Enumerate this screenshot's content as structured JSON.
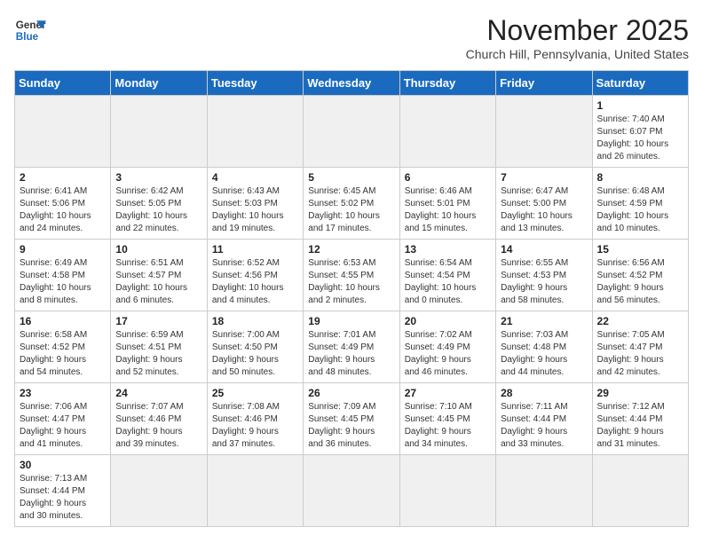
{
  "header": {
    "logo_text_line1": "General",
    "logo_text_line2": "Blue",
    "title": "November 2025",
    "subtitle": "Church Hill, Pennsylvania, United States"
  },
  "weekdays": [
    "Sunday",
    "Monday",
    "Tuesday",
    "Wednesday",
    "Thursday",
    "Friday",
    "Saturday"
  ],
  "weeks": [
    [
      {
        "day": "",
        "info": "",
        "empty": true
      },
      {
        "day": "",
        "info": "",
        "empty": true
      },
      {
        "day": "",
        "info": "",
        "empty": true
      },
      {
        "day": "",
        "info": "",
        "empty": true
      },
      {
        "day": "",
        "info": "",
        "empty": true
      },
      {
        "day": "",
        "info": "",
        "empty": true
      },
      {
        "day": "1",
        "info": "Sunrise: 7:40 AM\nSunset: 6:07 PM\nDaylight: 10 hours\nand 26 minutes."
      }
    ],
    [
      {
        "day": "2",
        "info": "Sunrise: 6:41 AM\nSunset: 5:06 PM\nDaylight: 10 hours\nand 24 minutes."
      },
      {
        "day": "3",
        "info": "Sunrise: 6:42 AM\nSunset: 5:05 PM\nDaylight: 10 hours\nand 22 minutes."
      },
      {
        "day": "4",
        "info": "Sunrise: 6:43 AM\nSunset: 5:03 PM\nDaylight: 10 hours\nand 19 minutes."
      },
      {
        "day": "5",
        "info": "Sunrise: 6:45 AM\nSunset: 5:02 PM\nDaylight: 10 hours\nand 17 minutes."
      },
      {
        "day": "6",
        "info": "Sunrise: 6:46 AM\nSunset: 5:01 PM\nDaylight: 10 hours\nand 15 minutes."
      },
      {
        "day": "7",
        "info": "Sunrise: 6:47 AM\nSunset: 5:00 PM\nDaylight: 10 hours\nand 13 minutes."
      },
      {
        "day": "8",
        "info": "Sunrise: 6:48 AM\nSunset: 4:59 PM\nDaylight: 10 hours\nand 10 minutes."
      }
    ],
    [
      {
        "day": "9",
        "info": "Sunrise: 6:49 AM\nSunset: 4:58 PM\nDaylight: 10 hours\nand 8 minutes."
      },
      {
        "day": "10",
        "info": "Sunrise: 6:51 AM\nSunset: 4:57 PM\nDaylight: 10 hours\nand 6 minutes."
      },
      {
        "day": "11",
        "info": "Sunrise: 6:52 AM\nSunset: 4:56 PM\nDaylight: 10 hours\nand 4 minutes."
      },
      {
        "day": "12",
        "info": "Sunrise: 6:53 AM\nSunset: 4:55 PM\nDaylight: 10 hours\nand 2 minutes."
      },
      {
        "day": "13",
        "info": "Sunrise: 6:54 AM\nSunset: 4:54 PM\nDaylight: 10 hours\nand 0 minutes."
      },
      {
        "day": "14",
        "info": "Sunrise: 6:55 AM\nSunset: 4:53 PM\nDaylight: 9 hours\nand 58 minutes."
      },
      {
        "day": "15",
        "info": "Sunrise: 6:56 AM\nSunset: 4:52 PM\nDaylight: 9 hours\nand 56 minutes."
      }
    ],
    [
      {
        "day": "16",
        "info": "Sunrise: 6:58 AM\nSunset: 4:52 PM\nDaylight: 9 hours\nand 54 minutes."
      },
      {
        "day": "17",
        "info": "Sunrise: 6:59 AM\nSunset: 4:51 PM\nDaylight: 9 hours\nand 52 minutes."
      },
      {
        "day": "18",
        "info": "Sunrise: 7:00 AM\nSunset: 4:50 PM\nDaylight: 9 hours\nand 50 minutes."
      },
      {
        "day": "19",
        "info": "Sunrise: 7:01 AM\nSunset: 4:49 PM\nDaylight: 9 hours\nand 48 minutes."
      },
      {
        "day": "20",
        "info": "Sunrise: 7:02 AM\nSunset: 4:49 PM\nDaylight: 9 hours\nand 46 minutes."
      },
      {
        "day": "21",
        "info": "Sunrise: 7:03 AM\nSunset: 4:48 PM\nDaylight: 9 hours\nand 44 minutes."
      },
      {
        "day": "22",
        "info": "Sunrise: 7:05 AM\nSunset: 4:47 PM\nDaylight: 9 hours\nand 42 minutes."
      }
    ],
    [
      {
        "day": "23",
        "info": "Sunrise: 7:06 AM\nSunset: 4:47 PM\nDaylight: 9 hours\nand 41 minutes."
      },
      {
        "day": "24",
        "info": "Sunrise: 7:07 AM\nSunset: 4:46 PM\nDaylight: 9 hours\nand 39 minutes."
      },
      {
        "day": "25",
        "info": "Sunrise: 7:08 AM\nSunset: 4:46 PM\nDaylight: 9 hours\nand 37 minutes."
      },
      {
        "day": "26",
        "info": "Sunrise: 7:09 AM\nSunset: 4:45 PM\nDaylight: 9 hours\nand 36 minutes."
      },
      {
        "day": "27",
        "info": "Sunrise: 7:10 AM\nSunset: 4:45 PM\nDaylight: 9 hours\nand 34 minutes."
      },
      {
        "day": "28",
        "info": "Sunrise: 7:11 AM\nSunset: 4:44 PM\nDaylight: 9 hours\nand 33 minutes."
      },
      {
        "day": "29",
        "info": "Sunrise: 7:12 AM\nSunset: 4:44 PM\nDaylight: 9 hours\nand 31 minutes."
      }
    ],
    [
      {
        "day": "30",
        "info": "Sunrise: 7:13 AM\nSunset: 4:44 PM\nDaylight: 9 hours\nand 30 minutes."
      },
      {
        "day": "",
        "info": "",
        "empty": true
      },
      {
        "day": "",
        "info": "",
        "empty": true
      },
      {
        "day": "",
        "info": "",
        "empty": true
      },
      {
        "day": "",
        "info": "",
        "empty": true
      },
      {
        "day": "",
        "info": "",
        "empty": true
      },
      {
        "day": "",
        "info": "",
        "empty": true
      }
    ]
  ]
}
